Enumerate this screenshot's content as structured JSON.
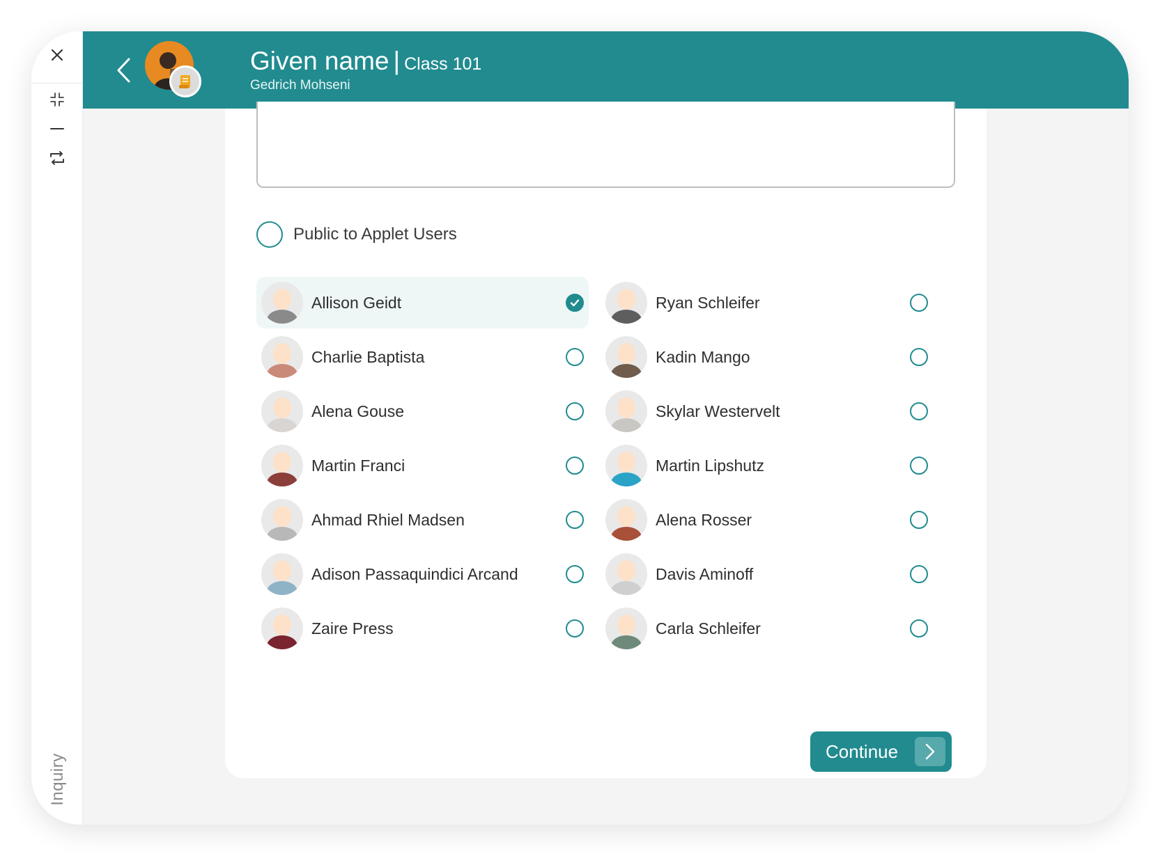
{
  "header": {
    "title": "Given name",
    "separator": "|",
    "class_name": "Class 101",
    "subtitle": "Gedrich Mohseni"
  },
  "side_rail": {
    "vertical_label": "Inquiry"
  },
  "visibility": {
    "label": "Public to Applet Users",
    "checked": false
  },
  "users": [
    {
      "name": "Allison Geidt",
      "selected": true,
      "avatar_color": "#8a8a8a"
    },
    {
      "name": "Ryan Schleifer",
      "selected": false,
      "avatar_color": "#5e5e5e"
    },
    {
      "name": "Charlie Baptista",
      "selected": false,
      "avatar_color": "#c98a7a"
    },
    {
      "name": "Kadin Mango",
      "selected": false,
      "avatar_color": "#6f5c4c"
    },
    {
      "name": "Alena Gouse",
      "selected": false,
      "avatar_color": "#d9d5d2"
    },
    {
      "name": "Skylar Westervelt",
      "selected": false,
      "avatar_color": "#c9c7c4"
    },
    {
      "name": "Martin Franci",
      "selected": false,
      "avatar_color": "#8b3e3a"
    },
    {
      "name": "Martin Lipshutz",
      "selected": false,
      "avatar_color": "#2aa3c6"
    },
    {
      "name": "Ahmad Rhiel Madsen",
      "selected": false,
      "avatar_color": "#b8b8b8"
    },
    {
      "name": "Alena Rosser",
      "selected": false,
      "avatar_color": "#a8503a"
    },
    {
      "name": "Adison Passaquindici Arcand",
      "selected": false,
      "avatar_color": "#8fb3c6"
    },
    {
      "name": "Davis Aminoff",
      "selected": false,
      "avatar_color": "#cfcfcf"
    },
    {
      "name": "Zaire Press",
      "selected": false,
      "avatar_color": "#7a2430"
    },
    {
      "name": "Carla Schleifer",
      "selected": false,
      "avatar_color": "#6f8a7a"
    }
  ],
  "actions": {
    "continue_label": "Continue"
  },
  "colors": {
    "accent": "#218b8f",
    "selected_row_bg": "#eef6f6"
  }
}
